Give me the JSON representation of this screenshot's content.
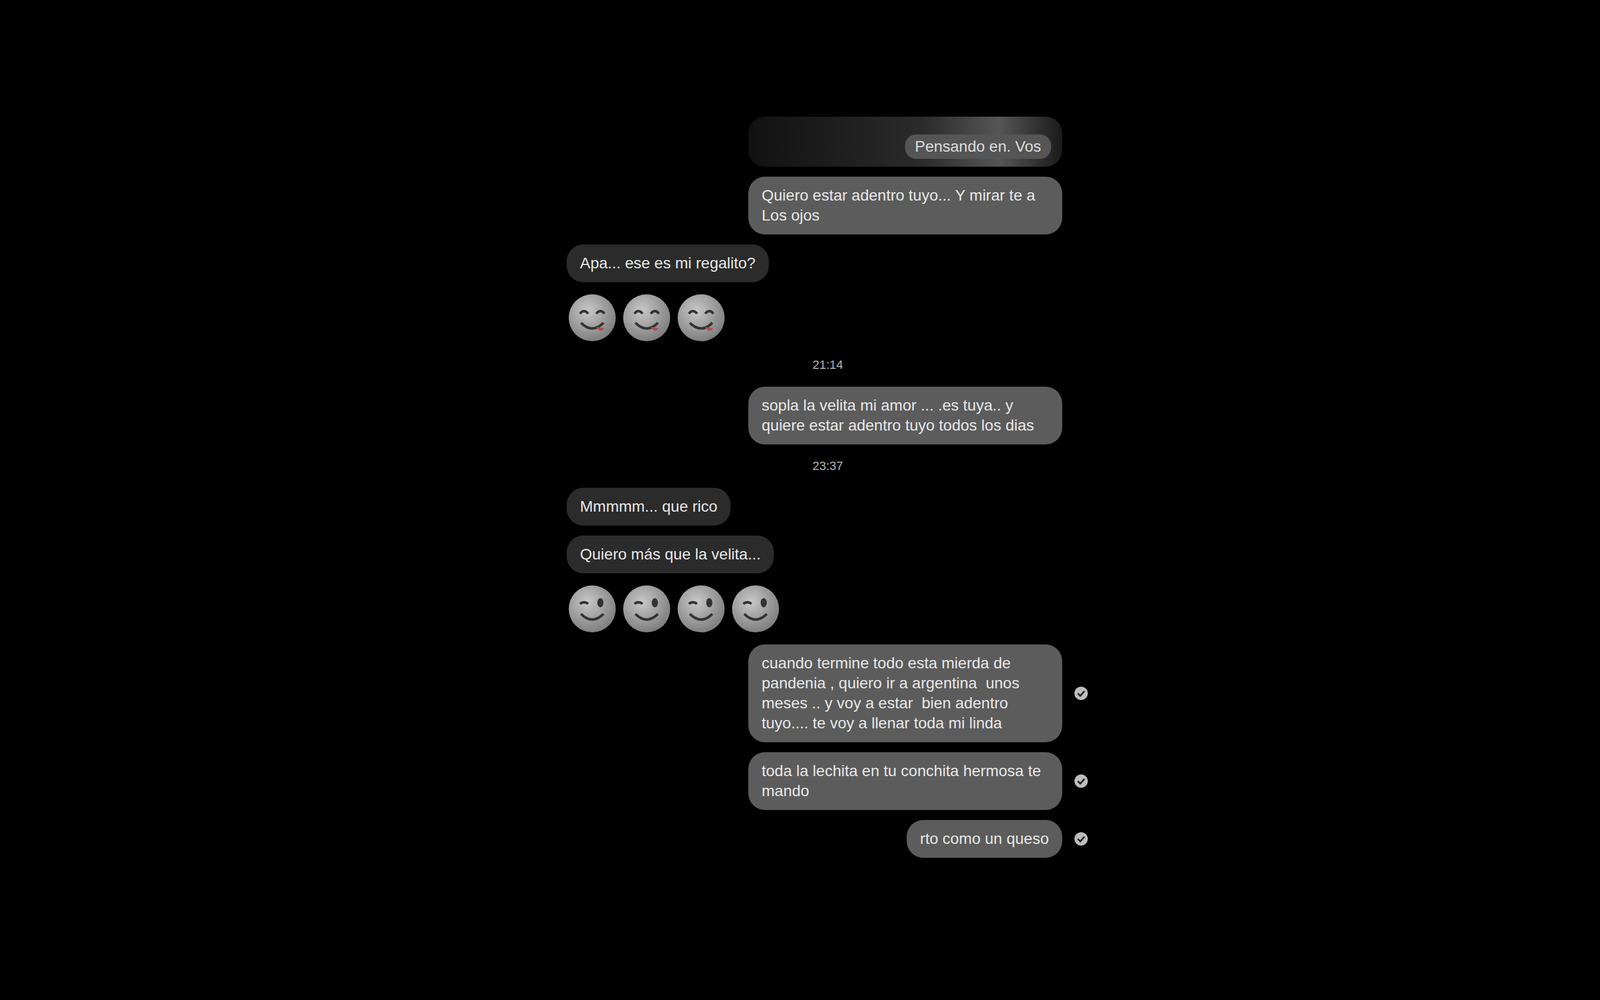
{
  "conversation": [
    {
      "kind": "image",
      "side": "out",
      "caption": "Pensando en. Vos",
      "read": false
    },
    {
      "kind": "text",
      "side": "out",
      "text": "Quiero estar adentro tuyo... Y mirar te a Los ojos",
      "read": false
    },
    {
      "kind": "text",
      "side": "in",
      "text": "Apa... ese es mi regalito?"
    },
    {
      "kind": "emoji",
      "side": "in",
      "face": "yum",
      "count": 3
    },
    {
      "kind": "time",
      "text": "21:14"
    },
    {
      "kind": "text",
      "side": "out",
      "text": "sopla la velita mi amor ... .es tuya.. y quiere estar adentro tuyo todos los dias",
      "read": false
    },
    {
      "kind": "time",
      "text": "23:37"
    },
    {
      "kind": "text",
      "side": "in",
      "text": "Mmmmm... que rico"
    },
    {
      "kind": "text",
      "side": "in",
      "text": "Quiero más que la velita..."
    },
    {
      "kind": "emoji",
      "side": "in",
      "face": "wink",
      "count": 4
    },
    {
      "kind": "text",
      "side": "out",
      "text": "cuando termine todo esta mierda de pandenia , quiero ir a argentina  unos meses .. y voy a estar  bien adentro tuyo.... te voy a llenar toda mi linda",
      "read": true
    },
    {
      "kind": "text",
      "side": "out",
      "text": "toda la lechita en tu conchita hermosa te mando",
      "read": true
    },
    {
      "kind": "text",
      "side": "out",
      "text": "rto como un queso",
      "read": true
    }
  ]
}
